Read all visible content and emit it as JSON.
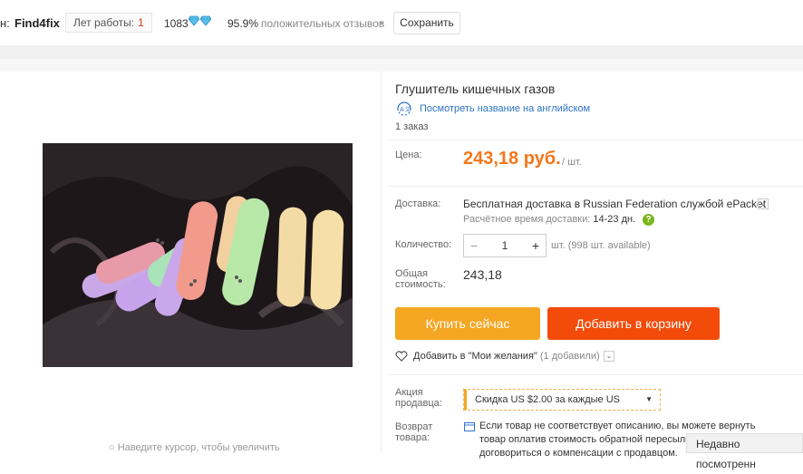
{
  "store": {
    "prefix": "н:",
    "name": "Find4fix",
    "years_label": "Лет работы:",
    "years_value": "1",
    "feedback_score": "1083",
    "positive_pct": "95.9%",
    "positive_label": "положительных отзывов",
    "save_label": "Сохранить"
  },
  "product": {
    "title": "Глушитель кишечных газов",
    "translate_link": "Посмотреть название на английском",
    "orders": "1 заказ",
    "price_label": "Цена:",
    "price": "243,18 руб.",
    "unit": "/ шт.",
    "delivery_label": "Доставка:",
    "delivery_text": "Бесплатная доставка в Russian Federation службой ePacket",
    "delivery_est_label": "Расчётное время доставки:",
    "delivery_est_days": "14-23 дн.",
    "quantity_label": "Количество:",
    "quantity_value": "1",
    "available": "шт. (998 шт. available)",
    "total_label_1": "Общая",
    "total_label_2": "стоимость:",
    "total_value": "243,18",
    "buy_now": "Купить сейчас",
    "add_to_cart": "Добавить в корзину",
    "wishlist": "Добавить в \"Мои желания\"",
    "wishlist_count": "(1 добавили)",
    "promo_label_1": "Акция",
    "promo_label_2": "продавца:",
    "promo_text": "Скидка US $2.00 за каждые US",
    "return_label_1": "Возврат",
    "return_label_2": "товара:",
    "return_text": "Если товар не соответствует описанию, вы можете вернуть товар оплатив стоимость обратной пересылки, или договориться о компенсации с продавцом."
  },
  "zoom_hint": "Наведите курсор, чтобы увеличить",
  "recently_viewed": "Недавно посмотренн",
  "colors": {
    "price": "#f5771a",
    "buy_button": "#f5a623",
    "cart_button": "#f24b0a",
    "link": "#2e73c5"
  }
}
